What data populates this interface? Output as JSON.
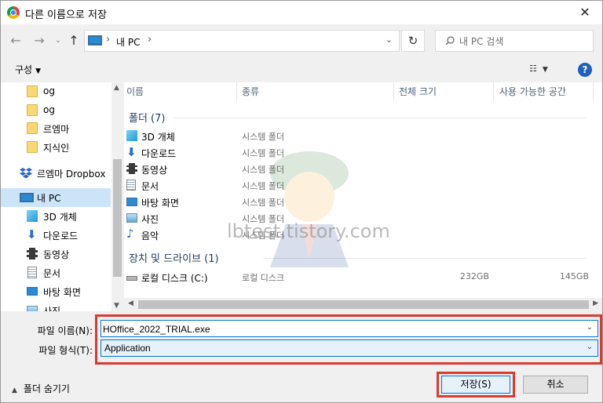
{
  "window": {
    "title": "다른 이름으로 저장",
    "close_label": "✕"
  },
  "address_bar": {
    "location": "내 PC",
    "separator": "›"
  },
  "search": {
    "placeholder": "내 PC 검색"
  },
  "toolbar": {
    "organize_label": "구성"
  },
  "nav_pane": {
    "items": [
      {
        "label": "og",
        "icon": "folder-icon"
      },
      {
        "label": "og",
        "icon": "folder-icon"
      },
      {
        "label": "르엠마",
        "icon": "folder-icon"
      },
      {
        "label": "지식인",
        "icon": "folder-icon"
      },
      {
        "label": "르엠마 Dropbox",
        "icon": "dropbox-icon"
      },
      {
        "label": "내 PC",
        "icon": "pc-icon",
        "selected": true
      },
      {
        "label": "3D 개체",
        "icon": "cube-icon"
      },
      {
        "label": "다운로드",
        "icon": "download-arrow-icon"
      },
      {
        "label": "동영상",
        "icon": "film-icon"
      },
      {
        "label": "문서",
        "icon": "document-icon"
      },
      {
        "label": "바탕 화면",
        "icon": "desktop-icon"
      },
      {
        "label": "사진",
        "icon": "picture-icon"
      }
    ]
  },
  "file_list": {
    "columns": [
      "이름",
      "종류",
      "전체 크기",
      "사용 가능한 공간"
    ],
    "folders_group": "폴더 (7)",
    "folders": [
      {
        "name": "3D 개체",
        "type": "시스템 폴더",
        "icon": "cube-icon"
      },
      {
        "name": "다운로드",
        "type": "시스템 폴더",
        "icon": "download-arrow-icon"
      },
      {
        "name": "동영상",
        "type": "시스템 폴더",
        "icon": "film-icon"
      },
      {
        "name": "문서",
        "type": "시스템 폴더",
        "icon": "document-icon"
      },
      {
        "name": "바탕 화면",
        "type": "시스템 폴더",
        "icon": "desktop-icon"
      },
      {
        "name": "사진",
        "type": "시스템 폴더",
        "icon": "picture-icon"
      },
      {
        "name": "음악",
        "type": "시스템 폴더",
        "icon": "music-note-icon"
      }
    ],
    "drives_group": "장치 및 드라이브 (1)",
    "drives": [
      {
        "name": "로컬 디스크 (C:)",
        "type": "로컬 디스크",
        "total": "232GB",
        "free": "145GB",
        "icon": "drive-icon"
      }
    ]
  },
  "watermark": "lbtest.tistory.com",
  "form": {
    "filename_label": "파일 이름(N):",
    "filename_value": "HOffice_2022_TRIAL.exe",
    "filetype_label": "파일 형식(T):",
    "filetype_value": "Application"
  },
  "footer": {
    "hide_folders_label": "폴더 숨기기",
    "save_label": "저장(S)",
    "cancel_label": "취소"
  },
  "colors": {
    "highlight_box": "#d93a32",
    "selection": "#cce4f7",
    "accent": "#0078d7"
  }
}
